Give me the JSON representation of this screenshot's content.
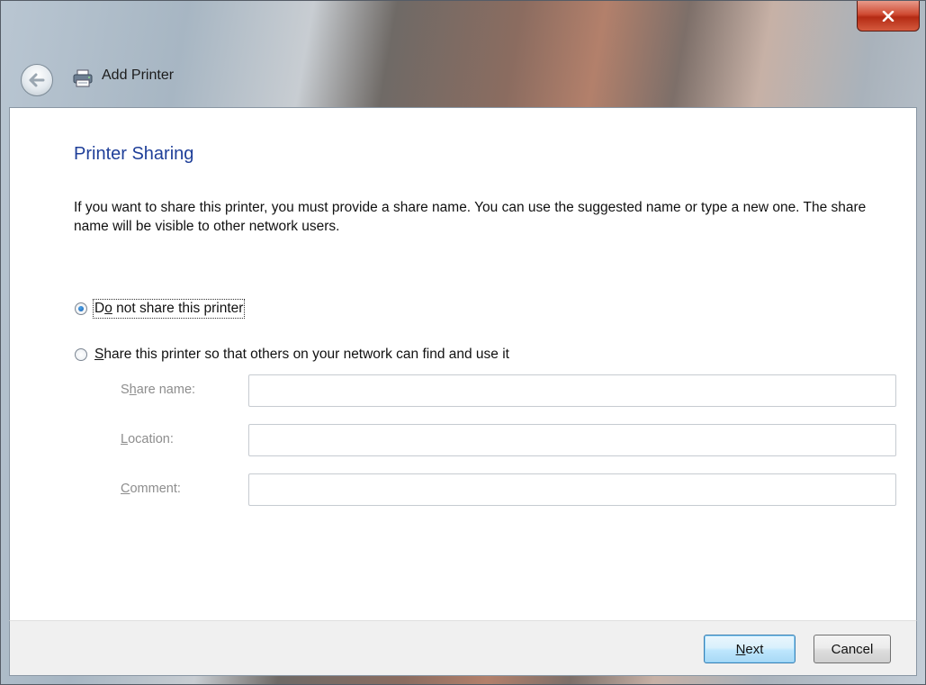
{
  "window": {
    "title": "Add Printer"
  },
  "page": {
    "heading": "Printer Sharing",
    "description": "If you want to share this printer, you must provide a share name. You can use the suggested name or type a new one. The share name will be visible to other network users."
  },
  "options": {
    "do_not_share": {
      "accel": "o",
      "pre": "D",
      "post": " not share this printer",
      "selected": true
    },
    "share": {
      "accel": "S",
      "pre": "",
      "post": "hare this printer so that others on your network can find and use it",
      "selected": false
    }
  },
  "fields": {
    "share_name": {
      "pre": "S",
      "accel": "h",
      "post": "are name:",
      "value": ""
    },
    "location": {
      "pre": "",
      "accel": "L",
      "post": "ocation:",
      "value": ""
    },
    "comment": {
      "pre": "",
      "accel": "C",
      "post": "omment:",
      "value": ""
    }
  },
  "buttons": {
    "next": {
      "accel": "N",
      "post": "ext"
    },
    "cancel": "Cancel"
  },
  "icons": {
    "close": "close-icon",
    "back": "back-arrow-icon",
    "printer": "printer-icon"
  }
}
